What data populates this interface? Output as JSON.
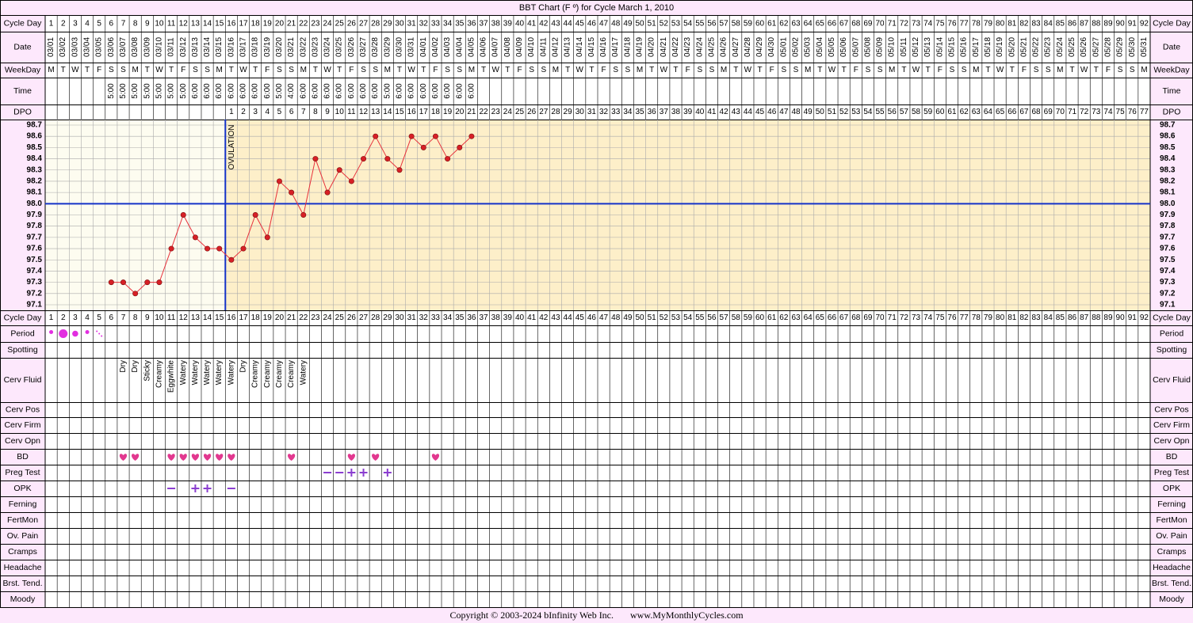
{
  "title": "BBT Chart (F º) for Cycle March 1, 2010",
  "footer": {
    "copyright": "Copyright © 2003-2024 bInfinity Web Inc.",
    "site": "www.MyMonthlyCycles.com"
  },
  "row_labels": {
    "cycle_day": "Cycle Day",
    "date": "Date",
    "weekday": "WeekDay",
    "time": "Time",
    "dpo": "DPO",
    "period": "Period",
    "spotting": "Spotting",
    "cerv_fluid": "Cerv Fluid",
    "cerv_pos": "Cerv Pos",
    "cerv_firm": "Cerv Firm",
    "cerv_opn": "Cerv Opn",
    "bd": "BD",
    "preg_test": "Preg Test",
    "opk": "OPK",
    "ferning": "Ferning",
    "fertmon": "FertMon",
    "ov_pain": "Ov. Pain",
    "cramps": "Cramps",
    "headache": "Headache",
    "brst_tend": "Brst. Tend.",
    "moody": "Moody"
  },
  "colors": {
    "page_bg": "#fde8fc",
    "pre_ovulation_bg": "#fdfcf0",
    "post_ovulation_bg": "#fdefc9",
    "grid": "#aaaaaa",
    "temp_line": "#e8303a",
    "temp_point": "#d72026",
    "coverline": "#1533c8",
    "ovulation_line": "#1533c8",
    "period": "#e22fe0",
    "bd_heart": "#e2388f",
    "test_marks": "#8b3ed0"
  },
  "ovulation_label": "OVULATION",
  "days": {
    "numbers": [
      "1",
      "2",
      "3",
      "4",
      "5",
      "6",
      "7",
      "8",
      "9",
      "10",
      "11",
      "12",
      "13",
      "14",
      "15",
      "16",
      "17",
      "18",
      "19",
      "20",
      "21",
      "22",
      "23",
      "24",
      "25",
      "26",
      "27",
      "28",
      "29",
      "30",
      "31",
      "32",
      "33",
      "34",
      "35",
      "36",
      "37",
      "38",
      "39",
      "40",
      "41",
      "42",
      "43",
      "44",
      "45",
      "46",
      "47",
      "48",
      "49",
      "50",
      "51",
      "52",
      "53",
      "54",
      "55",
      "56",
      "57",
      "58",
      "59",
      "60",
      "61",
      "62",
      "63",
      "64",
      "65",
      "66",
      "67",
      "68",
      "69",
      "70",
      "71",
      "72",
      "73",
      "74",
      "75",
      "76",
      "77",
      "78",
      "79",
      "80",
      "81",
      "82",
      "83",
      "84",
      "85",
      "86",
      "87",
      "88",
      "89",
      "90",
      "91",
      "92"
    ],
    "dates": [
      "03/01",
      "03/02",
      "03/03",
      "03/04",
      "03/05",
      "03/06",
      "03/07",
      "03/08",
      "03/09",
      "03/10",
      "03/11",
      "03/12",
      "03/13",
      "03/14",
      "03/15",
      "03/16",
      "03/17",
      "03/18",
      "03/19",
      "03/20",
      "03/21",
      "03/22",
      "03/23",
      "03/24",
      "03/25",
      "03/26",
      "03/27",
      "03/28",
      "03/29",
      "03/30",
      "03/31",
      "04/01",
      "04/02",
      "04/03",
      "04/04",
      "04/05",
      "04/06",
      "04/07",
      "04/08",
      "04/09",
      "04/10",
      "04/11",
      "04/12",
      "04/13",
      "04/14",
      "04/15",
      "04/16",
      "04/17",
      "04/18",
      "04/19",
      "04/20",
      "04/21",
      "04/22",
      "04/23",
      "04/24",
      "04/25",
      "04/26",
      "04/27",
      "04/28",
      "04/29",
      "04/30",
      "05/01",
      "05/02",
      "05/03",
      "05/04",
      "05/05",
      "05/06",
      "05/07",
      "05/08",
      "05/09",
      "05/10",
      "05/11",
      "05/12",
      "05/13",
      "05/14",
      "05/15",
      "05/16",
      "05/17",
      "05/18",
      "05/19",
      "05/20",
      "05/21",
      "05/22",
      "05/23",
      "05/24",
      "05/25",
      "05/26",
      "05/27",
      "05/28",
      "05/29",
      "05/30",
      "05/31"
    ],
    "weekdays": [
      "M",
      "T",
      "W",
      "T",
      "F",
      "S",
      "S",
      "M",
      "T",
      "W",
      "T",
      "F",
      "S",
      "S",
      "M",
      "T",
      "W",
      "T",
      "F",
      "S",
      "S",
      "M",
      "T",
      "W",
      "T",
      "F",
      "S",
      "S",
      "M",
      "T",
      "W",
      "T",
      "F",
      "S",
      "S",
      "M",
      "T",
      "W",
      "T",
      "F",
      "S",
      "S",
      "M",
      "T",
      "W",
      "T",
      "F",
      "S",
      "S",
      "M",
      "T",
      "W",
      "T",
      "F",
      "S",
      "S",
      "M",
      "T",
      "W",
      "T",
      "F",
      "S",
      "S",
      "M",
      "T",
      "W",
      "T",
      "F",
      "S",
      "S",
      "M",
      "T",
      "W",
      "T",
      "F",
      "S",
      "S",
      "M",
      "T",
      "W",
      "T",
      "F",
      "S",
      "S",
      "M",
      "T",
      "W",
      "T",
      "F",
      "S",
      "S",
      "M"
    ],
    "times": [
      "",
      "",
      "",
      "",
      "",
      "5:00",
      "5:00",
      "5:00",
      "5:00",
      "5:00",
      "5:00",
      "5:00",
      "6:00",
      "6:00",
      "6:00",
      "6:00",
      "6:00",
      "6:00",
      "6:00",
      "5:00",
      "4:00",
      "6:00",
      "6:00",
      "6:00",
      "6:00",
      "6:00",
      "6:00",
      "6:00",
      "5:00",
      "6:00",
      "6:00",
      "6:00",
      "6:00",
      "6:00",
      "6:00",
      "6:00",
      "",
      "",
      "",
      "",
      "",
      "",
      "",
      "",
      "",
      "",
      "",
      "",
      "",
      "",
      "",
      "",
      "",
      "",
      "",
      "",
      "",
      "",
      "",
      "",
      "",
      "",
      "",
      "",
      "",
      "",
      "",
      "",
      "",
      "",
      "",
      "",
      "",
      "",
      "",
      "",
      "",
      "",
      "",
      "",
      "",
      "",
      "",
      "",
      "",
      "",
      "",
      "",
      "",
      "",
      "",
      "",
      "",
      ""
    ],
    "dpo": [
      "",
      "",
      "",
      "",
      "",
      "",
      "",
      "",
      "",
      "",
      "",
      "",
      "",
      "",
      "",
      "1",
      "2",
      "3",
      "4",
      "5",
      "6",
      "7",
      "8",
      "9",
      "10",
      "11",
      "12",
      "13",
      "14",
      "15",
      "16",
      "17",
      "18",
      "19",
      "20",
      "21",
      "22",
      "23",
      "24",
      "25",
      "26",
      "27",
      "28",
      "29",
      "30",
      "31",
      "32",
      "33",
      "34",
      "35",
      "36",
      "37",
      "38",
      "39",
      "40",
      "41",
      "42",
      "43",
      "44",
      "45",
      "46",
      "47",
      "48",
      "49",
      "50",
      "51",
      "52",
      "53",
      "54",
      "55",
      "56",
      "57",
      "58",
      "59",
      "60",
      "61",
      "62",
      "63",
      "64",
      "65",
      "66",
      "67",
      "68",
      "69",
      "70",
      "71",
      "72",
      "73",
      "74",
      "75",
      "76",
      "77"
    ]
  },
  "chart_data": {
    "type": "line",
    "title": "BBT Chart (F º) for Cycle March 1, 2010",
    "x_label": "Cycle Day",
    "y_ticks": [
      "98.7",
      "98.6",
      "98.5",
      "98.4",
      "98.3",
      "98.2",
      "98.1",
      "98.0",
      "97.9",
      "97.8",
      "97.7",
      "97.6",
      "97.5",
      "97.4",
      "97.3",
      "97.2",
      "97.1"
    ],
    "ylim": [
      97.1,
      98.7
    ],
    "coverline": 98.0,
    "ovulation_day": 15,
    "series": [
      {
        "values": [
          null,
          null,
          null,
          null,
          null,
          97.3,
          97.3,
          97.2,
          97.3,
          97.3,
          97.6,
          97.9,
          97.7,
          97.6,
          97.6,
          97.5,
          97.6,
          97.9,
          97.7,
          98.2,
          98.1,
          97.9,
          98.4,
          98.1,
          98.3,
          98.2,
          98.4,
          98.6,
          98.4,
          98.3,
          98.6,
          98.5,
          98.6,
          98.4,
          98.5,
          98.6
        ]
      }
    ],
    "grid": true
  },
  "period": [
    {
      "day": 1,
      "size": "light"
    },
    {
      "day": 2,
      "size": "heavy"
    },
    {
      "day": 3,
      "size": "medium"
    },
    {
      "day": 4,
      "size": "light"
    },
    {
      "day": 5,
      "size": "spotting"
    }
  ],
  "cerv_fluid": [
    {
      "day": 7,
      "label": "Dry"
    },
    {
      "day": 8,
      "label": "Dry"
    },
    {
      "day": 9,
      "label": "Sticky"
    },
    {
      "day": 10,
      "label": "Creamy"
    },
    {
      "day": 11,
      "label": "Eggwhite"
    },
    {
      "day": 12,
      "label": "Watery"
    },
    {
      "day": 13,
      "label": "Watery"
    },
    {
      "day": 14,
      "label": "Watery"
    },
    {
      "day": 15,
      "label": "Watery"
    },
    {
      "day": 16,
      "label": "Watery"
    },
    {
      "day": 17,
      "label": "Dry"
    },
    {
      "day": 18,
      "label": "Creamy"
    },
    {
      "day": 19,
      "label": "Creamy"
    },
    {
      "day": 20,
      "label": "Creamy"
    },
    {
      "day": 21,
      "label": "Creamy"
    },
    {
      "day": 22,
      "label": "Watery"
    }
  ],
  "bd_days": [
    7,
    8,
    11,
    12,
    13,
    14,
    15,
    16,
    21,
    26,
    28,
    33
  ],
  "preg_test": [
    {
      "day": 24,
      "result": "negative"
    },
    {
      "day": 25,
      "result": "negative"
    },
    {
      "day": 26,
      "result": "positive"
    },
    {
      "day": 27,
      "result": "positive"
    },
    {
      "day": 29,
      "result": "positive"
    }
  ],
  "opk": [
    {
      "day": 11,
      "result": "negative"
    },
    {
      "day": 13,
      "result": "positive"
    },
    {
      "day": 14,
      "result": "positive"
    },
    {
      "day": 16,
      "result": "negative"
    }
  ]
}
